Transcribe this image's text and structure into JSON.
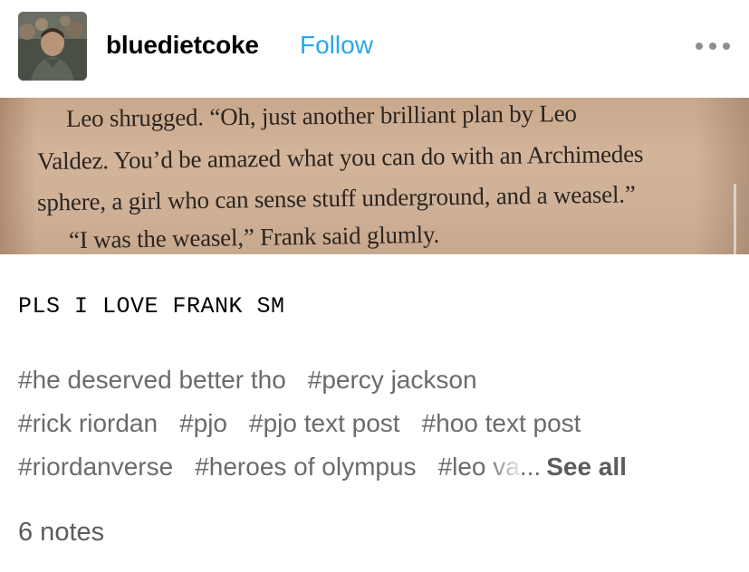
{
  "post": {
    "username": "bluedietcoke",
    "follow_label": "Follow",
    "more_icon": "more-options-icon",
    "book_lines": [
      "Leo shrugged. “Oh, just another brilliant plan by Leo",
      "Valdez. You’d be amazed what you can do with an Archimedes",
      "sphere, a girl who can sense stuff underground, and a weasel.”",
      "“I was the weasel,” Frank said glumly."
    ],
    "text": "PLS I LOVE FRANK SM",
    "tags_row1": [
      "#he deserved better tho",
      "#percy jackson"
    ],
    "tags_row2": [
      "#rick riordan",
      "#pjo",
      "#pjo text post",
      "#hoo text post"
    ],
    "tags_row3": [
      "#riordanverse",
      "#heroes of olympus",
      "#leo va"
    ],
    "tags_ellipsis": "...",
    "see_all_label": "See all",
    "notes": "6 notes"
  },
  "colors": {
    "follow": "#2aa7e8",
    "tag": "#6b6b6b",
    "muted": "#5c5c5c",
    "paper": "#d2b49a"
  }
}
